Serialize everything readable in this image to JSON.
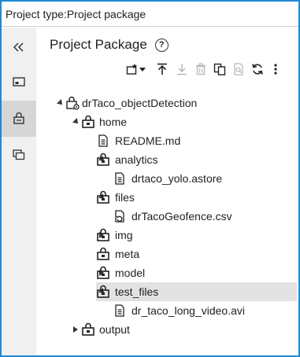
{
  "header": {
    "project_type_label": "Project type:Project package"
  },
  "rail": {
    "items": [
      {
        "icon": "collapse-double-chevron-icon"
      },
      {
        "icon": "image-panel-icon"
      },
      {
        "icon": "package-icon",
        "active": true
      },
      {
        "icon": "copy-icon"
      }
    ]
  },
  "panel": {
    "title": "Project Package",
    "help_icon": "?",
    "toolbar": [
      "new-item-icon",
      "dropdown-caret-icon",
      "upload-icon",
      "download-icon",
      "delete-icon",
      "copy-path-icon",
      "search-file-icon",
      "refresh-icon",
      "more-vertical-icon"
    ]
  },
  "tree": [
    {
      "label": "drTaco_objectDetection",
      "depth": 0,
      "twisty": "expanded",
      "icon": "project-package-icon"
    },
    {
      "label": "home",
      "depth": 1,
      "twisty": "expanded",
      "icon": "folder-lock-icon"
    },
    {
      "label": "README.md",
      "depth": 2,
      "twisty": "none",
      "icon": "text-file-icon"
    },
    {
      "label": "analytics",
      "depth": 2,
      "twisty": "expanded",
      "icon": "folder-lock-icon"
    },
    {
      "label": "drtaco_yolo.astore",
      "depth": 3,
      "twisty": "none",
      "icon": "text-file-icon"
    },
    {
      "label": "files",
      "depth": 2,
      "twisty": "expanded",
      "icon": "folder-lock-icon"
    },
    {
      "label": "drTacoGeofence.csv",
      "depth": 3,
      "twisty": "none",
      "icon": "sync-file-icon"
    },
    {
      "label": "img",
      "depth": 2,
      "twisty": "collapsed",
      "icon": "folder-lock-icon"
    },
    {
      "label": "meta",
      "depth": 2,
      "twisty": "none",
      "icon": "folder-lock-icon"
    },
    {
      "label": "model",
      "depth": 2,
      "twisty": "collapsed",
      "icon": "folder-lock-icon"
    },
    {
      "label": "test_files",
      "depth": 2,
      "twisty": "expanded",
      "icon": "folder-lock-icon",
      "selected": true
    },
    {
      "label": "dr_taco_long_video.avi",
      "depth": 3,
      "twisty": "none",
      "icon": "text-file-icon"
    },
    {
      "label": "output",
      "depth": 1,
      "twisty": "collapsed",
      "icon": "folder-lock-icon"
    }
  ],
  "colors": {
    "frame_border": "#1f8ad6",
    "rail_bg": "#f0f0f0",
    "rail_active": "#d6d6d6",
    "selected_row": "#e2e2e2"
  }
}
